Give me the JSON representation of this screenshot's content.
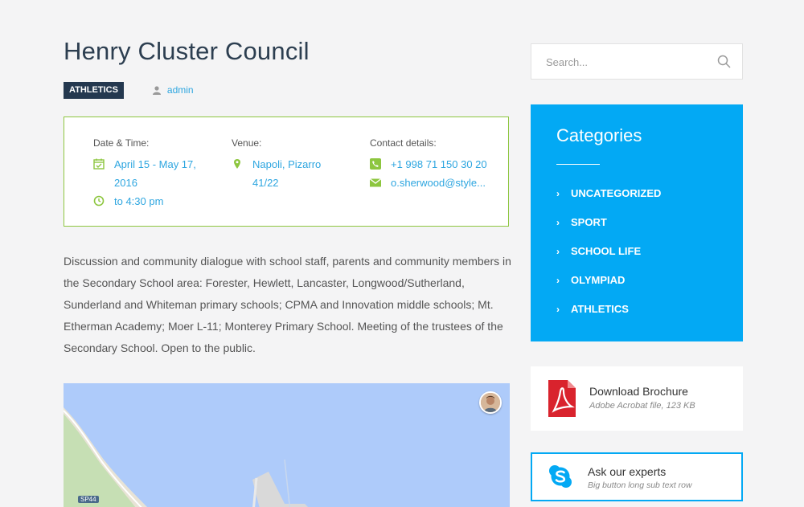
{
  "post": {
    "title": "Henry Cluster Council",
    "category_badge": "ATHLETICS",
    "author": "admin"
  },
  "event_info": {
    "datetime_label": "Date & Time:",
    "date_value": "April 15 - May 17, 2016",
    "time_value": "to 4:30 pm",
    "venue_label": "Venue:",
    "venue_value": "Napoli, Pizarro 41/22",
    "contact_label": "Contact details:",
    "phone_value": "+1 998 71 150 30 20",
    "email_value": "o.sherwood@style..."
  },
  "description": "Discussion and community dialogue with school staff, parents and community members in the Secondary School area: Forester, Hewlett, Lancaster, Longwood/Sutherland, Sunderland and Whiteman primary schools; CPMA and Innovation middle schools; Mt. Etherman Academy; Moer L-11; Monterey Primary School. Meeting of the trustees of the Secondary School. Open to the public.",
  "map": {
    "road_label": "SP44"
  },
  "sidebar": {
    "search_placeholder": "Search...",
    "categories_title": "Categories",
    "categories": [
      {
        "label": "UNCATEGORIZED"
      },
      {
        "label": "SPORT"
      },
      {
        "label": "SCHOOL LIFE"
      },
      {
        "label": "OLYMPIAD"
      },
      {
        "label": "ATHLETICS"
      }
    ],
    "brochure": {
      "title": "Download Brochure",
      "subtitle": "Adobe Acrobat file, 123 KB"
    },
    "experts": {
      "title": "Ask our experts",
      "subtitle": "Big button long sub text row"
    }
  },
  "colors": {
    "accent_blue": "#03a9f4",
    "link_blue": "#2ea6e0",
    "green": "#8dc63f",
    "badge_navy": "#24384f",
    "pdf_red": "#d9232d"
  },
  "icons": [
    "user-icon",
    "calendar-icon",
    "clock-icon",
    "map-pin-icon",
    "phone-icon",
    "mail-icon",
    "search-icon",
    "chevron-right-icon",
    "pdf-icon",
    "skype-icon"
  ]
}
